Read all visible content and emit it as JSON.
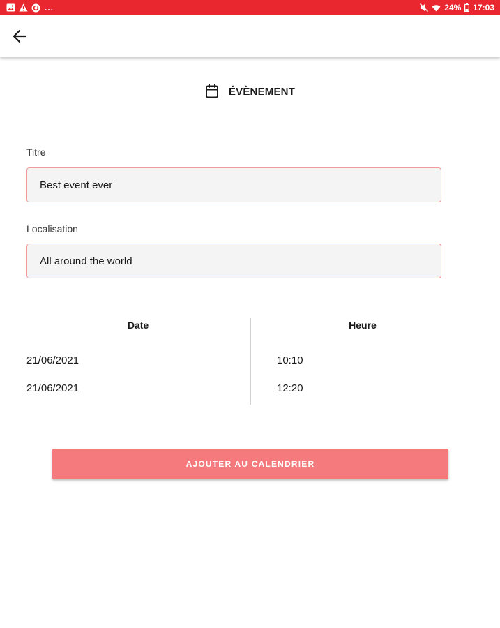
{
  "status_bar": {
    "notification_icons": [
      "image-icon",
      "warning-icon",
      "sync-icon"
    ],
    "overflow": "...",
    "battery": "24%",
    "time": "17:03"
  },
  "app_bar": {
    "back_icon": "arrow-left-icon"
  },
  "header": {
    "icon": "calendar-icon",
    "title": "ÉVÈNEMENT"
  },
  "form": {
    "title_label": "Titre",
    "title_value": "Best event ever",
    "location_label": "Localisation",
    "location_value": "All around the world"
  },
  "schedule": {
    "date_header": "Date",
    "time_header": "Heure",
    "rows": [
      {
        "date": "21/06/2021",
        "time": "10:10"
      },
      {
        "date": "21/06/2021",
        "time": "12:20"
      }
    ]
  },
  "action": {
    "add_label": "AJOUTER AU CALENDRIER"
  },
  "colors": {
    "status_bar": "#e8282e",
    "input_border": "#f29a9a",
    "button": "#f47a7d"
  }
}
